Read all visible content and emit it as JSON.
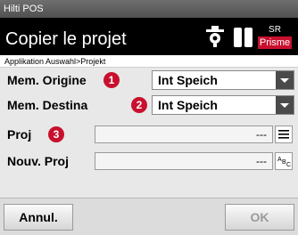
{
  "window": {
    "title": "Hilti POS"
  },
  "header": {
    "title": "Copier le projet",
    "status_top": "SR",
    "status_mode": "Prisme"
  },
  "breadcrumb": "Applikation Auswahl>Projekt",
  "form": {
    "mem_origine": {
      "label": "Mem. Origine",
      "badge": "1",
      "value": "Int Speich"
    },
    "mem_destina": {
      "label": "Mem. Destina",
      "badge": "2",
      "value": "Int Speich"
    },
    "proj": {
      "label": "Proj",
      "badge": "3",
      "value": "---"
    },
    "nouv_proj": {
      "label": "Nouv. Proj",
      "value": "---"
    }
  },
  "buttons": {
    "cancel": "Annul.",
    "ok": "OK"
  },
  "icons": {
    "prism": "prism-target-icon",
    "battery": "battery-icon",
    "list": "list-icon",
    "keyboard": "abc-keyboard-icon"
  },
  "colors": {
    "accent": "#c8102e",
    "header_bg": "#000000"
  }
}
